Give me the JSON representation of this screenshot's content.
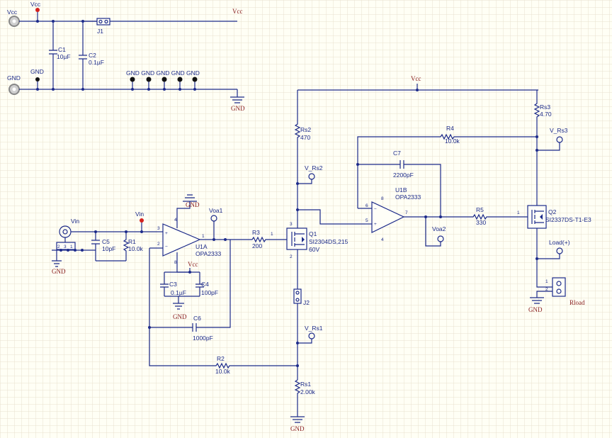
{
  "power": {
    "vcc_pin": "Vcc",
    "vcc_pin_node": "Vcc",
    "gnd_pin": "GND",
    "gnd_node": "GND",
    "gnd_header": "GND GND GND GND GND",
    "vcc_rail": "Vcc",
    "gnd_rail": "GND",
    "vcc_top": "Vcc",
    "vcc_u1": "Vcc",
    "gnd_u1": "GND",
    "gnd_c3": "GND",
    "gnd_in": "GND",
    "gnd_rs1": "GND",
    "gnd_load": "GND"
  },
  "components": {
    "j1": "J1",
    "c1": "C1",
    "c1_val": "10µF",
    "c2": "C2",
    "c2_val": "0.1µF",
    "c3": "C3",
    "c3_val": "0.1µF",
    "c4": "C4",
    "c4_val": "100pF",
    "c5": "C5",
    "c5_val": "10pF",
    "c6": "C6",
    "c6_val": "1000pF",
    "c7": "C7",
    "c7_val": "2200pF",
    "r1": "R1",
    "r1_val": "10.0k",
    "r2": "R2",
    "r2_val": "10.0k",
    "r3": "R3",
    "r3_val": "200",
    "r4": "R4",
    "r4_val": "10.0k",
    "r5": "R5",
    "r5_val": "330",
    "rs1": "Rs1",
    "rs1_val": "2.00k",
    "rs2": "Rs2",
    "rs2_val": "470",
    "rs3": "Rs3",
    "rs3_val": "4.70",
    "u1a": "U1A",
    "u1a_part": "OPA2333",
    "u1b": "U1B",
    "u1b_part": "OPA2333",
    "q1": "Q1",
    "q1_part": "SI2304DS,215",
    "q1_v": "60V",
    "q2": "Q2",
    "q2_part": "SI2337DS-T1-E3",
    "j2": "J2",
    "rload": "Rload"
  },
  "nets": {
    "vin": "Vin",
    "vin_probe": "Vin",
    "voa1": "Voa1",
    "voa2": "Voa2",
    "v_rs1": "V_Rs1",
    "v_rs2": "V_Rs2",
    "v_rs3": "V_Rs3",
    "load": "Load(+)"
  },
  "pins": {
    "u1a_p3": "3",
    "u1a_p2": "2",
    "u1a_p1": "1",
    "u1a_p4": "4",
    "u1a_p8": "8",
    "u1b_p5": "5",
    "u1b_p6": "6",
    "u1b_p7": "7",
    "u1b_p4": "4",
    "u1b_p8": "8",
    "one": "1",
    "two": "2",
    "three": "3"
  },
  "colors": {
    "wire": "#1c2a8a",
    "power_label": "#8a2020",
    "test_point": "#d4211e",
    "background": "#fffff5"
  }
}
